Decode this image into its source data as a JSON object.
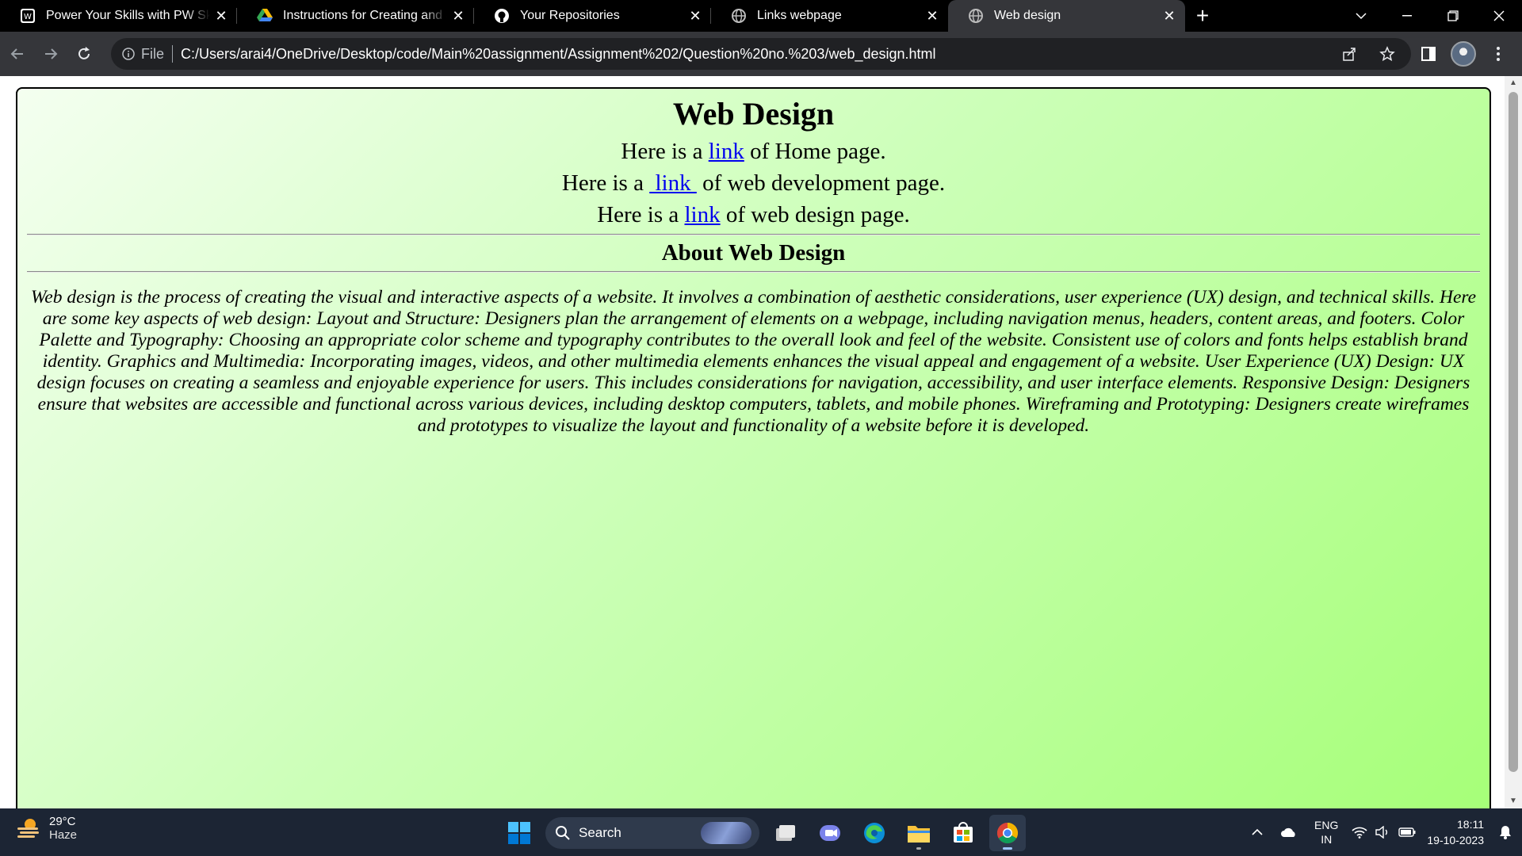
{
  "browser": {
    "tabs": [
      {
        "title": "Power Your Skills with PW Skills",
        "favicon": "pw-skills-icon",
        "active": false
      },
      {
        "title": "Instructions for Creating and Sub",
        "favicon": "google-drive-icon",
        "active": false
      },
      {
        "title": "Your Repositories",
        "favicon": "github-icon",
        "active": false
      },
      {
        "title": "Links webpage",
        "favicon": "globe-icon",
        "active": false
      },
      {
        "title": "Web design",
        "favicon": "globe-icon",
        "active": true
      }
    ],
    "address": {
      "scheme_label": "File",
      "url": "C:/Users/arai4/OneDrive/Desktop/code/Main%20assignment/Assignment%202/Question%20no.%203/web_design.html"
    }
  },
  "page": {
    "heading": "Web Design",
    "link_lines": [
      {
        "before": "Here is a ",
        "link": "link",
        "after": " of Home page."
      },
      {
        "before": "Here is a ",
        "link": " link ",
        "after": " of web development page."
      },
      {
        "before": "Here is a ",
        "link": "link",
        "after": " of web design page."
      }
    ],
    "subheading": "About Web Design",
    "paragraph": "Web design is the process of creating the visual and interactive aspects of a website. It involves a combination of aesthetic considerations, user experience (UX) design, and technical skills. Here are some key aspects of web design: Layout and Structure: Designers plan the arrangement of elements on a webpage, including navigation menus, headers, content areas, and footers. Color Palette and Typography: Choosing an appropriate color scheme and typography contributes to the overall look and feel of the website. Consistent use of colors and fonts helps establish brand identity. Graphics and Multimedia: Incorporating images, videos, and other multimedia elements enhances the visual appeal and engagement of a website. User Experience (UX) Design: UX design focuses on creating a seamless and enjoyable experience for users. This includes considerations for navigation, accessibility, and user interface elements. Responsive Design: Designers ensure that websites are accessible and functional across various devices, including desktop computers, tablets, and mobile phones. Wireframing and Prototyping: Designers create wireframes and prototypes to visualize the layout and functionality of a website before it is developed."
  },
  "taskbar": {
    "weather_temp": "29°C",
    "weather_desc": "Haze",
    "search_label": "Search",
    "lang_top": "ENG",
    "lang_bottom": "IN",
    "time": "18:11",
    "date": "19-10-2023"
  },
  "colors": {
    "link": "#0000ee",
    "page_gradient_start": "#f4fff0",
    "page_gradient_end": "#a6ff78"
  }
}
